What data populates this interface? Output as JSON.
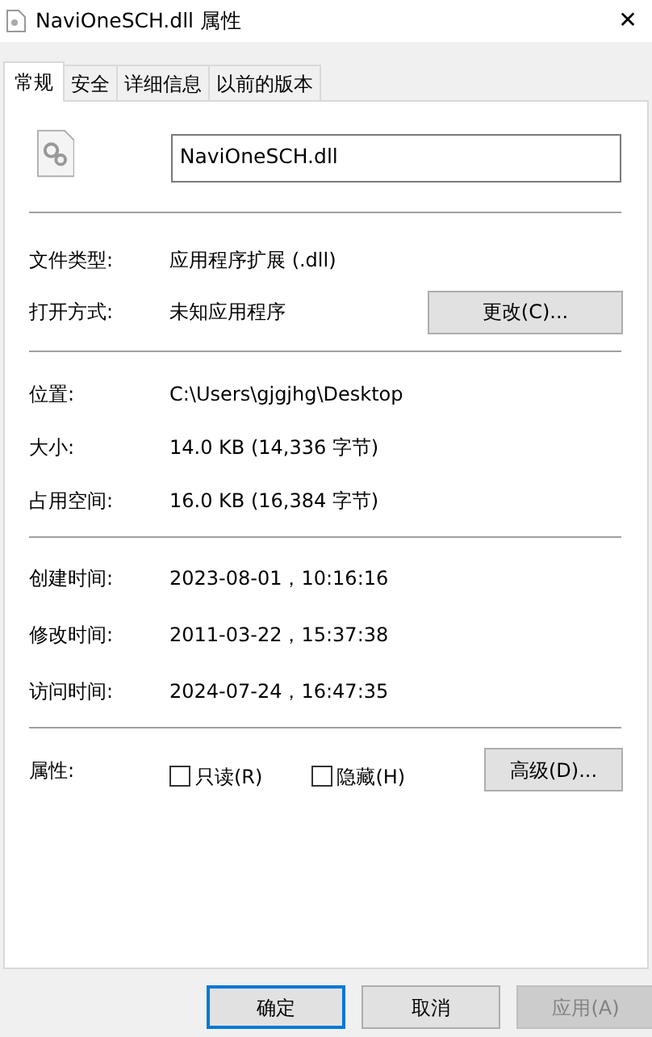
{
  "window": {
    "title": "NaviOneSCH.dll 属性",
    "close": "✕"
  },
  "tabs": [
    {
      "label": "常规",
      "selected": true
    },
    {
      "label": "安全",
      "selected": false
    },
    {
      "label": "详细信息",
      "selected": false
    },
    {
      "label": "以前的版本",
      "selected": false
    }
  ],
  "file_name": "NaviOneSCH.dll",
  "type_rows": [
    {
      "label": "文件类型:",
      "value": "应用程序扩展 (.dll)"
    },
    {
      "label": "打开方式:",
      "value": "未知应用程序",
      "button": "更改(C)..."
    }
  ],
  "location_rows": [
    {
      "label": "位置:",
      "value": "C:\\Users\\gjgjhg\\Desktop"
    },
    {
      "label": "大小:",
      "value": "14.0 KB (14,336 字节)"
    },
    {
      "label": "占用空间:",
      "value": "16.0 KB (16,384 字节)"
    }
  ],
  "time_rows": [
    {
      "label": "创建时间:",
      "value": "2023-08-01，10:16:16"
    },
    {
      "label": "修改时间:",
      "value": "2011-03-22，15:37:38"
    },
    {
      "label": "访问时间:",
      "value": "2024-07-24，16:47:35"
    }
  ],
  "attributes": {
    "label": "属性:",
    "checkboxes": [
      {
        "label": "只读(R)",
        "checked": false
      },
      {
        "label": "隐藏(H)",
        "checked": false
      }
    ],
    "button": "高级(D)..."
  },
  "buttons": [
    {
      "label": "确定",
      "default": true,
      "disabled": false
    },
    {
      "label": "取消",
      "default": false,
      "disabled": false
    },
    {
      "label": "应用(A)",
      "default": false,
      "disabled": true
    }
  ]
}
